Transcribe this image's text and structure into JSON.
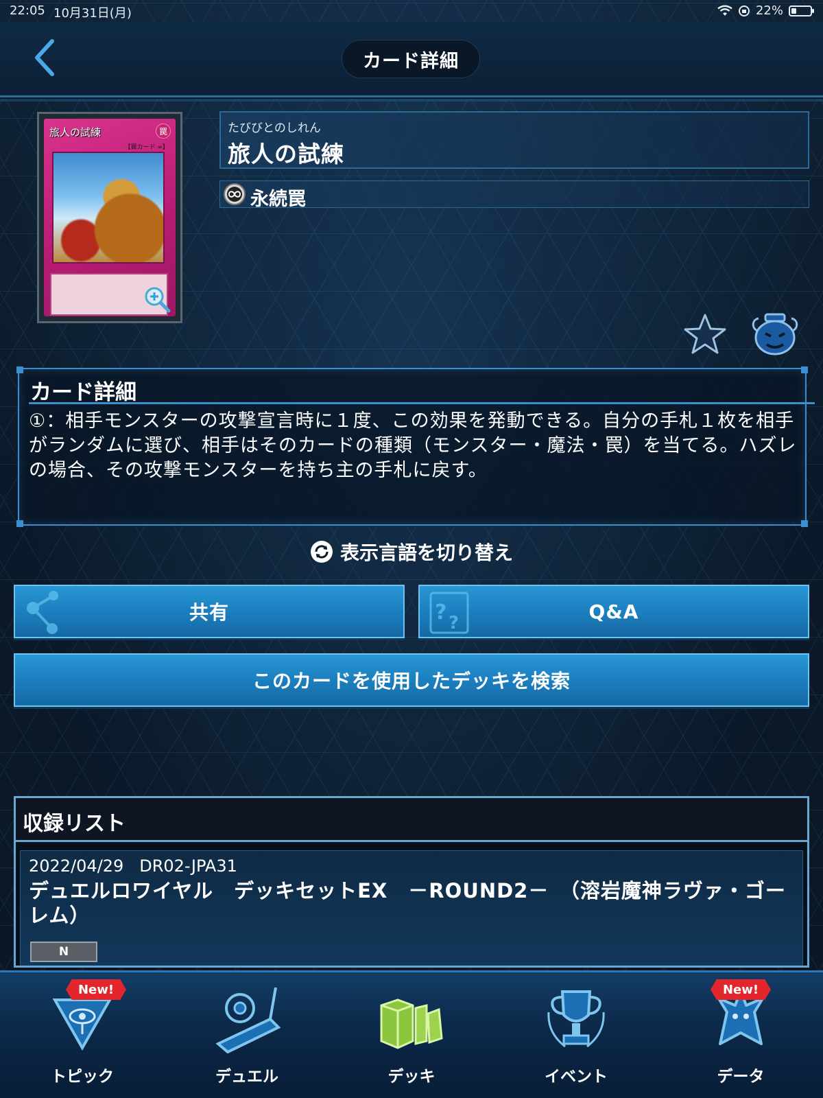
{
  "status_bar": {
    "time": "22:05",
    "date": "10月31日(月)",
    "battery": "22%"
  },
  "header": {
    "title": "カード詳細"
  },
  "card": {
    "image_name": "旅人の試練",
    "image_attribute": "罠",
    "image_type": "【罠カード ∞】",
    "ruby": "たびびとのしれん",
    "name": "旅人の試練",
    "type": "永続罠"
  },
  "description": {
    "title": "カード詳細",
    "text": "①：相手モンスターの攻撃宣言時に１度、この効果を発動できる。自分の手札１枚を相手がランダムに選び、相手はそのカードの種類（モンスター・魔法・罠）を当てる。ハズレの場合、その攻撃モンスターを持ち主の手札に戻す。"
  },
  "actions": {
    "language_toggle": "表示言語を切り替え",
    "share": "共有",
    "qa": "Q&A",
    "search_decks": "このカードを使用したデッキを検索"
  },
  "release_list": {
    "title": "収録リスト",
    "items": [
      {
        "date": "2022/04/29",
        "code": "DR02-JPA31",
        "title": "デュエルロワイヤル　デッキセットEX　－ROUND2－　（溶岩魔神ラヴァ・ゴーレム）",
        "rarity": "N"
      }
    ]
  },
  "nav": {
    "items": [
      {
        "label": "トピック",
        "badge": "New!"
      },
      {
        "label": "デュエル",
        "badge": ""
      },
      {
        "label": "デッキ",
        "badge": ""
      },
      {
        "label": "イベント",
        "badge": ""
      },
      {
        "label": "データ",
        "badge": "New!"
      }
    ]
  },
  "colors": {
    "accent": "#2a97d4",
    "panel_border": "#3a8fcf",
    "badge": "#e3262c",
    "card_trap": "#c8246e"
  }
}
